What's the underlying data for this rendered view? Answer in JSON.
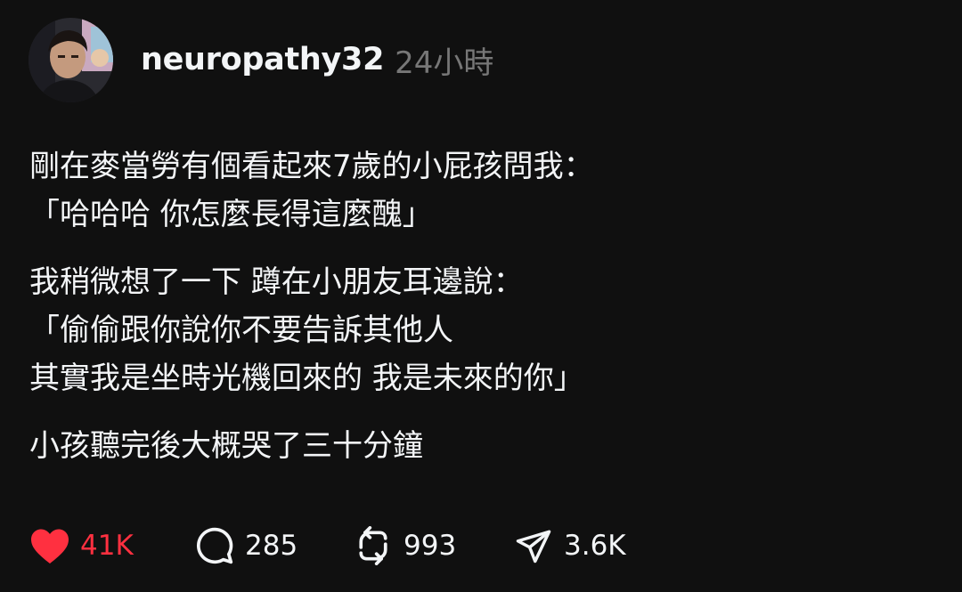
{
  "post": {
    "author": {
      "username": "neuropathy32",
      "timestamp": "24小時"
    },
    "paragraphs": [
      [
        "剛在麥當勞有個看起來7歲的小屁孩問我：",
        "「哈哈哈 你怎麼長得這麼醜」"
      ],
      [
        "我稍微想了一下 蹲在小朋友耳邊說：",
        "「偷偷跟你說你不要告訴其他人",
        "其實我是坐時光機回來的 我是未來的你」"
      ],
      [
        "小孩聽完後大概哭了三十分鐘"
      ]
    ],
    "actions": {
      "like": {
        "icon": "heart-icon",
        "count": "41K",
        "liked": true,
        "color": "#ff3040"
      },
      "reply": {
        "icon": "comment-icon",
        "count": "285"
      },
      "repost": {
        "icon": "repost-icon",
        "count": "993"
      },
      "share": {
        "icon": "send-icon",
        "count": "3.6K"
      }
    }
  },
  "colors": {
    "background": "#101010",
    "text": "#f3f5f7",
    "muted": "#777777",
    "like": "#ff3040"
  }
}
